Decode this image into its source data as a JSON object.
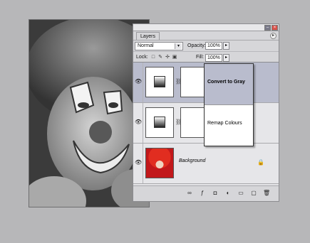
{
  "panel": {
    "tab_label": "Layers",
    "blend_mode": "Normal",
    "opacity_label": "Opacity:",
    "opacity_value": "100%",
    "lock_label": "Lock:",
    "fill_label": "Fill:",
    "fill_value": "100%"
  },
  "layers": [
    {
      "name": "Convert to Gray",
      "selected": true,
      "type": "adjustment"
    },
    {
      "name": "Remap Colours",
      "selected": false,
      "type": "adjustment"
    },
    {
      "name": "Background",
      "selected": false,
      "type": "image"
    }
  ],
  "colors": {
    "selected_row": "#b9bccd",
    "panel_bg": "#d6d6d9",
    "canvas_bg": "#b7b7b9"
  },
  "icons": {
    "eye": "eye-icon",
    "chain": "link-icon",
    "lock": "lock-icon",
    "bottom": [
      "link-layers-icon",
      "fx-icon",
      "mask-icon",
      "adjustment-icon",
      "group-icon",
      "new-layer-icon",
      "trash-icon"
    ]
  }
}
